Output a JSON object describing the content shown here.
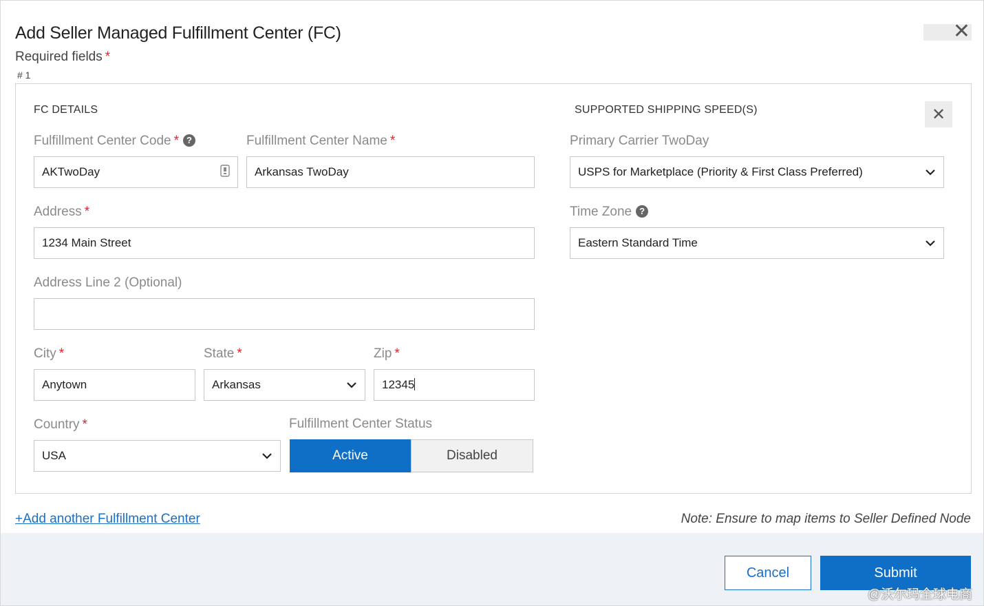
{
  "dialog": {
    "title": "Add Seller Managed Fulfillment Center (FC)",
    "required_label": "Required fields",
    "required_marker": "*",
    "fc_number": "# 1",
    "close_glyph": "✕"
  },
  "fc_details": {
    "section_title": "FC DETAILS",
    "fc_code": {
      "label": "Fulfillment Center Code",
      "value": "AKTwoDay",
      "help": "?"
    },
    "fc_name": {
      "label": "Fulfillment Center Name",
      "value": "Arkansas TwoDay"
    },
    "address": {
      "label": "Address",
      "value": "1234 Main Street"
    },
    "address2": {
      "label": "Address Line 2 (Optional)",
      "value": ""
    },
    "city": {
      "label": "City",
      "value": "Anytown"
    },
    "state": {
      "label": "State",
      "value": "Arkansas"
    },
    "zip": {
      "label": "Zip",
      "value": "12345"
    },
    "country": {
      "label": "Country",
      "value": "USA"
    },
    "status": {
      "label": "Fulfillment Center Status",
      "active": "Active",
      "disabled": "Disabled",
      "selected": "Active"
    }
  },
  "shipping": {
    "section_title": "SUPPORTED SHIPPING SPEED(S)",
    "close_glyph": "✕",
    "primary_carrier": {
      "label": "Primary Carrier TwoDay",
      "value": "USPS for Marketplace (Priority & First Class Preferred)"
    },
    "time_zone": {
      "label": "Time Zone",
      "value": "Eastern Standard Time",
      "help": "?"
    }
  },
  "add_link": "+Add another Fulfillment Center",
  "note": "Note: Ensure to map items to Seller Defined Node",
  "footer": {
    "cancel": "Cancel",
    "submit": "Submit"
  },
  "watermark": "@沃尔玛全球电商",
  "colors": {
    "accent": "#0f6fc6",
    "required": "#e0242c",
    "footer_bg": "#eef1f5"
  }
}
